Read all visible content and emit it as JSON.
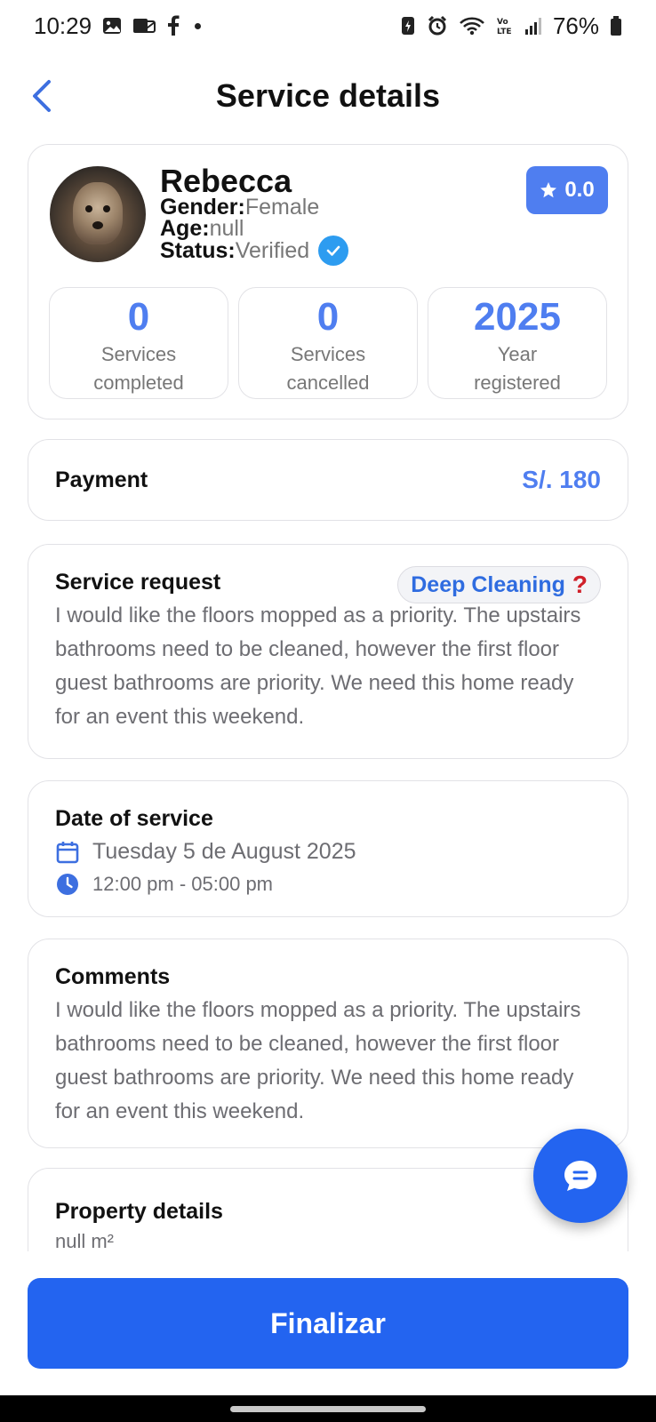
{
  "status_bar": {
    "time": "10:29",
    "battery": "76%"
  },
  "header": {
    "title": "Service details"
  },
  "profile": {
    "name": "Rebecca",
    "gender_label": "Gender:",
    "gender_value": "Female",
    "age_label": "Age:",
    "age_value": "null",
    "status_label": "Status:",
    "status_value": "Verified",
    "rating": "0.0",
    "stats": [
      {
        "value": "0",
        "caption_line1": "Services",
        "caption_line2": "completed"
      },
      {
        "value": "0",
        "caption_line1": "Services",
        "caption_line2": "cancelled"
      },
      {
        "value": "2025",
        "caption_line1": "Year",
        "caption_line2": "registered"
      }
    ]
  },
  "payment": {
    "label": "Payment",
    "amount": "S/. 180"
  },
  "service_request": {
    "title": "Service request",
    "type": "Deep Cleaning",
    "type_help_glyph": "?",
    "description": "I would like the floors mopped as a priority. The upstairs bathrooms need to be cleaned, however the first floor guest bathrooms are priority. We need this home ready for an event this weekend."
  },
  "date_of_service": {
    "title": "Date of service",
    "date": "Tuesday 5 de August 2025",
    "time_range": "12:00 pm - 05:00 pm"
  },
  "comments": {
    "title": "Comments",
    "text": "I would like the floors mopped as a priority. The upstairs bathrooms need to be cleaned, however the first floor guest bathrooms are priority. We need this home ready for an event this weekend."
  },
  "property_details": {
    "title": "Property details",
    "area": "null m²"
  },
  "actions": {
    "finalize_label": "Finalizar"
  },
  "colors": {
    "accent": "#4f7ef0",
    "primary_button": "#2364f0",
    "verified": "#2d9cf0",
    "help": "#d0202a"
  }
}
